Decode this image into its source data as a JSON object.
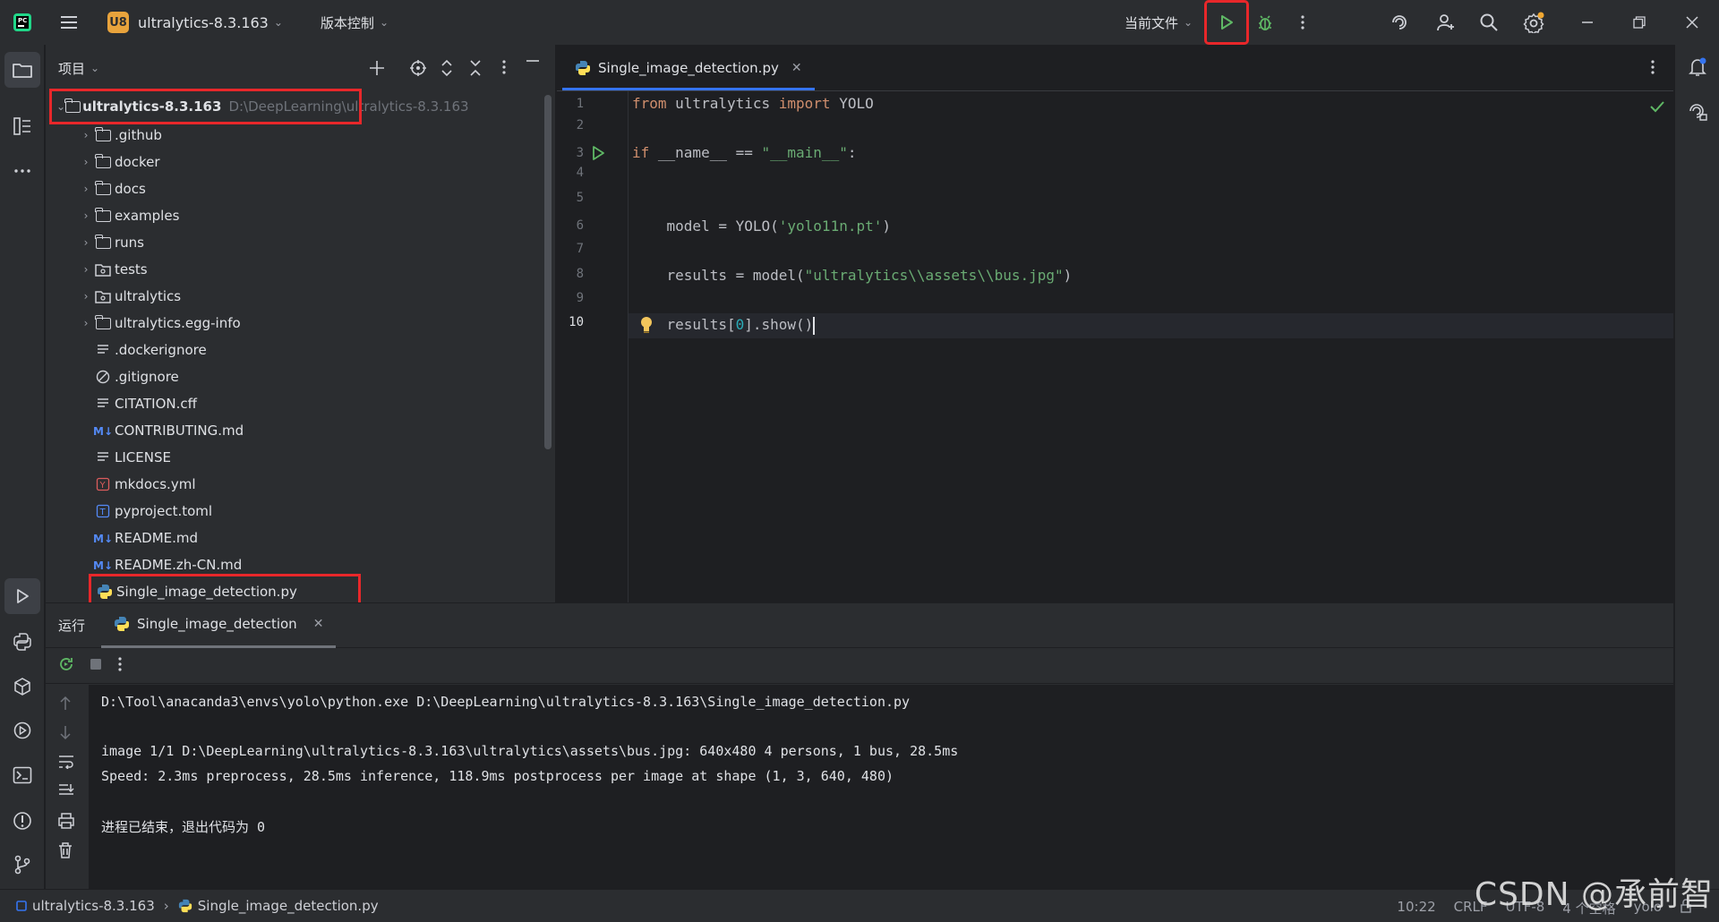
{
  "titlebar": {
    "project_badge": "U8",
    "project_name": "ultralytics-8.3.163",
    "vcs_menu": "版本控制",
    "run_config": "当前文件"
  },
  "sidebar": {
    "panel_title": "项目",
    "root": {
      "name": "ultralytics-8.3.163",
      "path": "D:\\DeepLearning\\ultralytics-8.3.163"
    },
    "items": [
      {
        "name": ".github",
        "type": "folder"
      },
      {
        "name": "docker",
        "type": "folder"
      },
      {
        "name": "docs",
        "type": "folder"
      },
      {
        "name": "examples",
        "type": "folder"
      },
      {
        "name": "runs",
        "type": "folder"
      },
      {
        "name": "tests",
        "type": "package"
      },
      {
        "name": "ultralytics",
        "type": "package"
      },
      {
        "name": "ultralytics.egg-info",
        "type": "folder"
      },
      {
        "name": ".dockerignore",
        "type": "text"
      },
      {
        "name": ".gitignore",
        "type": "ignore"
      },
      {
        "name": "CITATION.cff",
        "type": "text"
      },
      {
        "name": "CONTRIBUTING.md",
        "type": "markdown"
      },
      {
        "name": "LICENSE",
        "type": "text"
      },
      {
        "name": "mkdocs.yml",
        "type": "yaml"
      },
      {
        "name": "pyproject.toml",
        "type": "toml"
      },
      {
        "name": "README.md",
        "type": "markdown"
      },
      {
        "name": "README.zh-CN.md",
        "type": "markdown"
      },
      {
        "name": "Single_image_detection.py",
        "type": "python"
      }
    ]
  },
  "editor": {
    "tab_label": "Single_image_detection.py",
    "line_numbers": [
      "1",
      "2",
      "3",
      "4",
      "5",
      "6",
      "7",
      "8",
      "9",
      "10"
    ],
    "code": {
      "l1_kw1": "from",
      "l1_mid": " ultralytics ",
      "l1_kw2": "import",
      "l1_end": " YOLO",
      "l3_kw": "if",
      "l3_mid": " __name__ == ",
      "l3_str": "\"__main__\"",
      "l3_end": ":",
      "l6_a": "    model = YOLO(",
      "l6_str": "'yolo11n.pt'",
      "l6_b": ")",
      "l8_a": "    results = model(",
      "l8_str": "\"ultralytics\\\\assets\\\\bus.jpg\"",
      "l8_b": ")",
      "l10_a": "    results[",
      "l10_num": "0",
      "l10_b": "].show()"
    }
  },
  "run_panel": {
    "title": "运行",
    "tab_label": "Single_image_detection",
    "console": [
      "D:\\Tool\\anacanda3\\envs\\yolo\\python.exe D:\\DeepLearning\\ultralytics-8.3.163\\Single_image_detection.py",
      "",
      "image 1/1 D:\\DeepLearning\\ultralytics-8.3.163\\ultralytics\\assets\\bus.jpg: 640x480 4 persons, 1 bus, 28.5ms",
      "Speed: 2.3ms preprocess, 28.5ms inference, 118.9ms postprocess per image at shape (1, 3, 640, 480)",
      "",
      "进程已结束，退出代码为 0"
    ]
  },
  "statusbar": {
    "breadcrumb_project": "ultralytics-8.3.163",
    "breadcrumb_file": "Single_image_detection.py",
    "position": "10:22",
    "line_ending": "CRLF",
    "encoding": "UTF-8",
    "indent": "4 个空格",
    "interpreter": "yolo"
  },
  "watermark": "CSDN @承前智",
  "colors": {
    "accent": "#3574f0",
    "highlight": "#e8272a",
    "run_green": "#5fb865"
  }
}
